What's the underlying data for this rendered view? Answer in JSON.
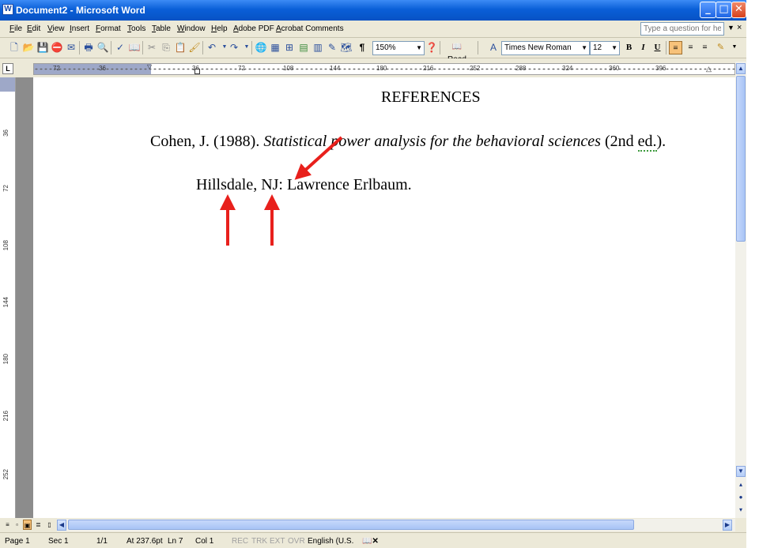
{
  "window": {
    "title": "Document2 - Microsoft Word",
    "app_icon": "W",
    "minimize": "_",
    "maximize": "□",
    "close": "✕"
  },
  "menu": {
    "items": [
      "File",
      "Edit",
      "View",
      "Insert",
      "Format",
      "Tools",
      "Table",
      "Window",
      "Help",
      "Adobe PDF",
      "Acrobat Comments"
    ],
    "help_placeholder": "Type a question for help",
    "help_close": "×"
  },
  "toolbar": {
    "zoom": "150%",
    "read_label": "Read",
    "font": "Times New Roman",
    "font_size": "12",
    "bold": "B",
    "italic": "I",
    "underline": "U"
  },
  "ruler": {
    "tab_selector": "L",
    "h_ticks": [
      "72",
      "36",
      "36",
      "72",
      "108",
      "144",
      "180",
      "216",
      "252",
      "288",
      "324",
      "360",
      "396"
    ],
    "v_ticks": [
      "36",
      "72",
      "108",
      "144",
      "180",
      "216",
      "252"
    ]
  },
  "document": {
    "heading": "REFERENCES",
    "line1_author": "Cohen, J. (1988). ",
    "line1_title": "Statistical power analysis for the behavioral sciences",
    "line1_edition_open": " (2nd ",
    "line1_edition_word": "ed.",
    "line1_edition_close": ").",
    "line2": "Hillsdale, NJ: Lawrence Erlbaum."
  },
  "status": {
    "page": "Page 1",
    "section": "Sec 1",
    "pages": "1/1",
    "at": "At 237.6pt",
    "line": "Ln 7",
    "col": "Col 1",
    "rec": "REC",
    "trk": "TRK",
    "ext": "EXT",
    "ovr": "OVR",
    "language": "English (U.S."
  },
  "colors": {
    "annotation_arrow": "#e8201c",
    "title_bar": "#0a5fd8"
  }
}
